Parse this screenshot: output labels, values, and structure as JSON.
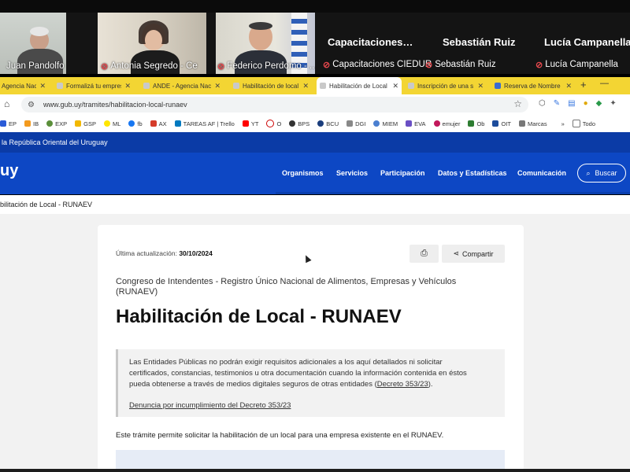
{
  "meeting": {
    "participants": [
      {
        "name": "Juan Pandolfo",
        "muted": false
      },
      {
        "name": "Antonia Segredo - Ce",
        "muted": true
      },
      {
        "name": "Federico Perdomo - ...",
        "muted": true
      }
    ],
    "audio_only": [
      {
        "big": "Capacitaciones…",
        "small": "Capacitaciones CIEDUR",
        "muted": true
      },
      {
        "big": "Sebastián Ruiz",
        "small": "Sebastián Ruiz",
        "muted": true
      },
      {
        "big": "Lucía Campanella",
        "small": "Lucía Campanella",
        "muted": true
      }
    ]
  },
  "browser": {
    "tabs": [
      {
        "title": "Agencia Nac",
        "active": false
      },
      {
        "title": "Formalizá tu empres",
        "active": false
      },
      {
        "title": "ANDE - Agencia Nac",
        "active": false
      },
      {
        "title": "Habilitación de local",
        "active": false
      },
      {
        "title": "Habilitación de Local",
        "active": true
      },
      {
        "title": "Inscripción de una s",
        "active": false
      },
      {
        "title": "Reserva de Nombre",
        "active": false
      }
    ],
    "new_tab": "+",
    "url": "www.gub.uy/tramites/habilitacion-local-runaev",
    "bookmarks": [
      "EP",
      "IB",
      "EXP",
      "GSP",
      "ML",
      "fb",
      "AX",
      "TAREAS AF | Trello",
      "YT",
      "O",
      "BPS",
      "BCU",
      "DGI",
      "MIEM",
      "EVA",
      "emujer",
      "Ob",
      "OIT",
      "Marcas",
      "Todo"
    ]
  },
  "site": {
    "gov_bar": "la República Oriental del Uruguay",
    "logo": "uy",
    "nav": [
      "Organismos",
      "Servicios",
      "Participación",
      "Datos y Estadísticas",
      "Comunicación"
    ],
    "search_label": "Buscar",
    "breadcrumb": "bilitación de Local - RUNAEV"
  },
  "page": {
    "updated_label": "Última actualización:",
    "updated_date": "30/10/2024",
    "share_label": "Compartir",
    "organization": "Congreso de Intendentes - Registro Único Nacional de Alimentos, Empresas y Vehículos (RUNAEV)",
    "title": "Habilitación de Local - RUNAEV",
    "notice_text": "Las Entidades Públicas no podrán exigir requisitos adicionales a los aquí detallados ni solicitar certificados, constancias, testimonios u otra documentación cuando la información contenida en éstos pueda obtenerse a través de medios digitales seguros de otras entidades (",
    "notice_link": "Decreto 353/23",
    "notice_end": ").",
    "complaint_link": "Denuncia por incumplimiento del Decreto 353/23",
    "lede": "Este trámite permite solicitar la habilitación de un local para una empresa existente en el RUNAEV."
  }
}
